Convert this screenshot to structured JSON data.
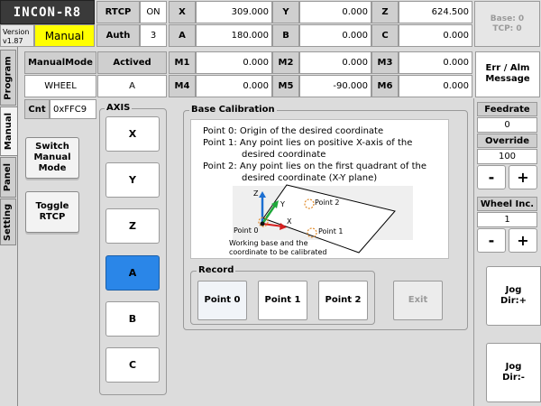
{
  "app": {
    "title": "INCON-R8",
    "version": "Version\nv1.87",
    "mode": "Manual"
  },
  "status": {
    "rtcp_label": "RTCP",
    "rtcp_value": "ON",
    "auth_label": "Auth",
    "auth_value": "3",
    "x_label": "X",
    "x_value": "309.000",
    "y_label": "Y",
    "y_value": "0.000",
    "z_label": "Z",
    "z_value": "624.500",
    "a_label": "A",
    "a_value": "180.000",
    "b_label": "B",
    "b_value": "0.000",
    "c_label": "C",
    "c_value": "0.000",
    "base_tcp": "Base: 0\nTCP: 0"
  },
  "mode_info": {
    "manual_mode_label": "ManualMode",
    "manual_mode_value": "WHEEL",
    "actived_label": "Actived",
    "actived_value": "A",
    "cnt_label": "Cnt",
    "cnt_value": "0xFFC9"
  },
  "m_registers": {
    "m1_label": "M1",
    "m1_value": "0.000",
    "m2_label": "M2",
    "m2_value": "0.000",
    "m3_label": "M3",
    "m3_value": "0.000",
    "m4_label": "M4",
    "m4_value": "0.000",
    "m5_label": "M5",
    "m5_value": "-90.000",
    "m6_label": "M6",
    "m6_value": "0.000"
  },
  "side_tabs": [
    "Program",
    "Manual",
    "Panel",
    "Setting"
  ],
  "left_buttons": {
    "switch_manual_mode": "Switch\nManual\nMode",
    "toggle_rtcp": "Toggle\nRTCP"
  },
  "axis": {
    "title": "AXIS",
    "buttons": [
      "X",
      "Y",
      "Z",
      "A",
      "B",
      "C"
    ],
    "selected": "A"
  },
  "base_calibration": {
    "title": "Base Calibration",
    "lines": [
      "Point 0: Origin of the desired coordinate",
      "Point 1: Any point lies on positive X-axis of the",
      "desired coordinate",
      "Point 2: Any point lies on the first quadrant of the",
      "desired coordinate (X-Y plane)"
    ],
    "diagram": {
      "z": "Z",
      "y": "Y",
      "x": "X",
      "point0": "Point 0",
      "point1": "Point 1",
      "point2": "Point 2",
      "caption": "Working base and the\ncoordinate to be calibrated"
    }
  },
  "record": {
    "title": "Record",
    "point0": "Point 0",
    "point1": "Point 1",
    "point2": "Point 2",
    "exit": "Exit"
  },
  "right_panel": {
    "err_alm": "Err / Alm\nMessage",
    "feedrate_label": "Feedrate",
    "feedrate_value": "0",
    "override_label": "Override",
    "override_value": "100",
    "wheel_inc_label": "Wheel Inc.",
    "wheel_inc_value": "1",
    "minus": "-",
    "plus": "+",
    "jog_plus": "Jog\nDir:+",
    "jog_minus": "Jog\nDir:-"
  },
  "colors": {
    "mode_bg": "#ffff00",
    "title_bg": "#3a3a3a",
    "axis_selected": "#2a86e8",
    "diagram_blue": "#1c6fd1",
    "diagram_green": "#1fa83a",
    "diagram_red": "#d62020",
    "diagram_orange": "#e08a2b"
  }
}
